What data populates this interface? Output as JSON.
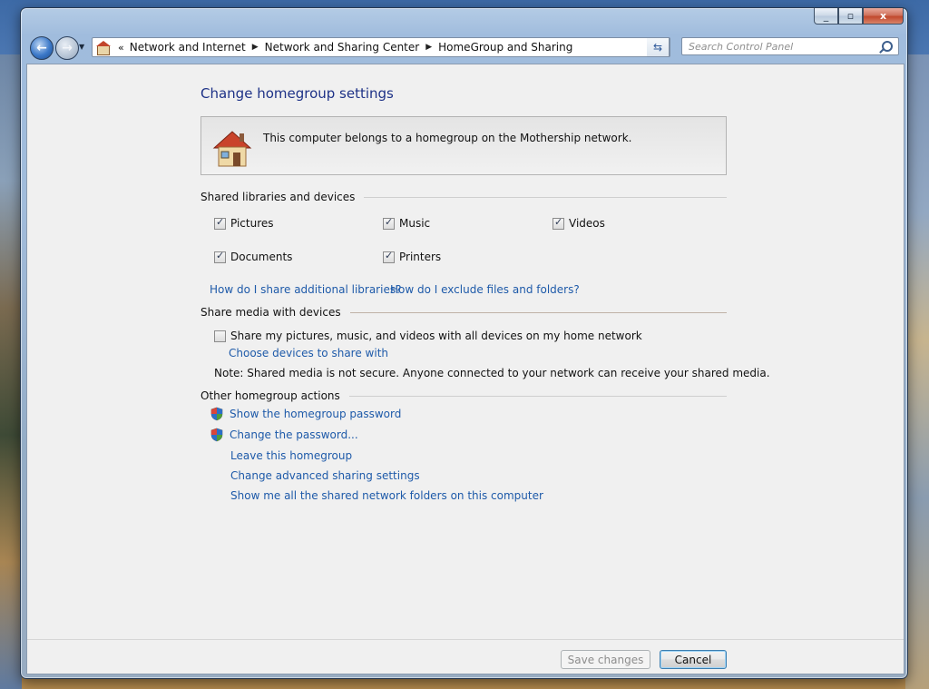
{
  "window": {
    "caption": {
      "minimize": "_",
      "maximize": "▫",
      "close": "x"
    }
  },
  "address_bar": {
    "overflow": "«",
    "crumbs": [
      "Network and Internet",
      "Network and Sharing Center",
      "HomeGroup and Sharing"
    ],
    "separator": "▶",
    "dropdown": "▼",
    "refresh": "⇆"
  },
  "search": {
    "placeholder": "Search Control Panel"
  },
  "page": {
    "title": "Change homegroup settings",
    "info": "This computer belongs to a homegroup on the Mothership network."
  },
  "shared_libraries": {
    "heading": "Shared libraries and devices",
    "items": [
      {
        "label": "Pictures",
        "checked": true
      },
      {
        "label": "Music",
        "checked": true
      },
      {
        "label": "Videos",
        "checked": true
      },
      {
        "label": "Documents",
        "checked": true
      },
      {
        "label": "Printers",
        "checked": true
      }
    ],
    "links": [
      "How do I share additional libraries?",
      "How do I exclude files and folders?"
    ]
  },
  "media": {
    "heading": "Share media with devices",
    "checkbox": {
      "label": "Share my pictures, music, and videos with all devices on my home network",
      "checked": false
    },
    "link": "Choose devices to share with",
    "note": "Note: Shared media is not secure. Anyone connected to your network can receive your shared media."
  },
  "actions": {
    "heading": "Other homegroup actions",
    "links": [
      "Show the homegroup password",
      "Change the password...",
      "Leave this homegroup",
      "Change advanced sharing settings",
      "Show me all the shared network folders on this computer"
    ]
  },
  "footer": {
    "save": "Save changes",
    "cancel": "Cancel"
  },
  "colors": {
    "link": "#1e5aa9",
    "title": "#1e3287"
  }
}
